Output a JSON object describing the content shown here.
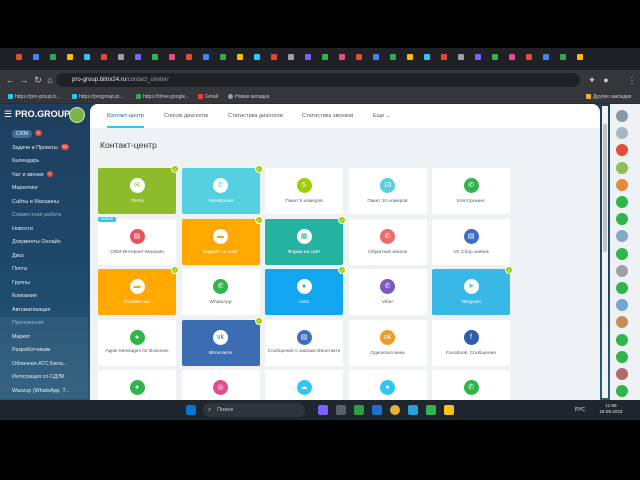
{
  "browser": {
    "url_host": "pro-group.bitrix24.ru",
    "url_path": "/contact_center/",
    "bookmarks": [
      "https://pro-group.b...",
      "https://progroup.pl...",
      "https://drive.google...",
      "Gmail",
      "Новая вкладка"
    ],
    "bookmarks_right": "Другие закладки"
  },
  "app": {
    "logo": "PRO.GROUP",
    "sidebar": [
      {
        "label": "CRM",
        "badge": "5"
      },
      {
        "label": "Задачи и Проекты",
        "badge": "99"
      },
      {
        "label": "Календарь",
        "badge": ""
      },
      {
        "label": "Чат и звонки",
        "badge": "1"
      },
      {
        "label": "Маркетинг",
        "badge": ""
      },
      {
        "label": "Сайты и Магазины",
        "badge": ""
      },
      {
        "label": "Совместная работа",
        "badge": ""
      },
      {
        "label": "Новости",
        "badge": ""
      },
      {
        "label": "Документы Онлайн",
        "badge": ""
      },
      {
        "label": "Диск",
        "badge": ""
      },
      {
        "label": "Почта",
        "badge": ""
      },
      {
        "label": "Группы",
        "badge": ""
      },
      {
        "label": "Компания",
        "badge": ""
      },
      {
        "label": "Автоматизация",
        "badge": ""
      },
      {
        "label": "Приложения",
        "badge": ""
      },
      {
        "label": "Маркет",
        "badge": ""
      },
      {
        "label": "Разработчикам",
        "badge": ""
      },
      {
        "label": "Облачная АТС Била...",
        "badge": ""
      },
      {
        "label": "Интеграция со СДЭК",
        "badge": ""
      },
      {
        "label": "Wazzup (WhatsApp, T...",
        "badge": ""
      }
    ]
  },
  "topnav": {
    "tabs": [
      "Контакт-центр",
      "Список диалогов",
      "Статистика диалогов",
      "Статистика звонков",
      "Еще"
    ]
  },
  "page_title": "Контакт-центр",
  "tiles": [
    {
      "label": "Почта",
      "icon": "mail-icon",
      "glyph": "✉",
      "bg": "#8dbb2c",
      "ic_bg": "#ffffff",
      "ic_fg": "#8dbb2c",
      "connected": true,
      "filled": true
    },
    {
      "label": "Телефония",
      "icon": "phone-icon",
      "glyph": "✆",
      "bg": "#55d0e0",
      "ic_bg": "#ffffff",
      "ic_fg": "#55d0e0",
      "connected": true,
      "filled": true
    },
    {
      "label": "Пакет 5 номеров",
      "icon": "number-pack-icon",
      "glyph": "5",
      "bg": "#ffffff",
      "ic_bg": "#9dcf00",
      "ic_fg": "#ffffff",
      "connected": false,
      "filled": false
    },
    {
      "label": "Пакет 10 номеров",
      "icon": "number-pack-icon",
      "glyph": "10",
      "bg": "#ffffff",
      "ic_bg": "#55d0e0",
      "ic_fg": "#ffffff",
      "connected": false,
      "filled": false
    },
    {
      "label": "Коллтрекинг",
      "icon": "calltracking-icon",
      "glyph": "✆",
      "bg": "#ffffff",
      "ic_bg": "#2fb54c",
      "ic_fg": "#ffffff",
      "connected": false,
      "filled": false
    },
    {
      "label": "CRM-Интернет-Магазин",
      "icon": "shop-icon",
      "glyph": "▤",
      "bg": "#ffffff",
      "ic_bg": "#e4545f",
      "ic_fg": "#ffffff",
      "connected": false,
      "filled": false,
      "tag": "НОВОЕ"
    },
    {
      "label": "Виджет на сайт",
      "icon": "widget-icon",
      "glyph": "▬",
      "bg": "#ffa900",
      "ic_bg": "#ffffff",
      "ic_fg": "#ffa900",
      "connected": true,
      "filled": true
    },
    {
      "label": "Форма на сайт",
      "icon": "form-icon",
      "glyph": "▦",
      "bg": "#25b3a1",
      "ic_bg": "#ffffff",
      "ic_fg": "#25b3a1",
      "connected": true,
      "filled": true
    },
    {
      "label": "Обратный звонок",
      "icon": "callback-icon",
      "glyph": "✆",
      "bg": "#ffffff",
      "ic_bg": "#ef6a6a",
      "ic_fg": "#ffffff",
      "connected": false,
      "filled": false
    },
    {
      "label": "VK Сбор заявок",
      "icon": "vk-leads-icon",
      "glyph": "▤",
      "bg": "#ffffff",
      "ic_bg": "#3c6dbf",
      "ic_fg": "#ffffff",
      "connected": false,
      "filled": false
    },
    {
      "label": "Онлайн-чат",
      "icon": "chat-icon",
      "glyph": "▬",
      "bg": "#ffa900",
      "ic_bg": "#ffffff",
      "ic_fg": "#ffa900",
      "connected": true,
      "filled": true
    },
    {
      "label": "WhatsApp",
      "icon": "whatsapp-icon",
      "glyph": "✆",
      "bg": "#ffffff",
      "ic_bg": "#2fb54c",
      "ic_fg": "#ffffff",
      "connected": false,
      "filled": false
    },
    {
      "label": "Avito",
      "icon": "avito-icon",
      "glyph": "●",
      "bg": "#12a6f0",
      "ic_bg": "#ffffff",
      "ic_fg": "#12a6f0",
      "connected": true,
      "filled": true
    },
    {
      "label": "Viber",
      "icon": "viber-icon",
      "glyph": "✆",
      "bg": "#ffffff",
      "ic_bg": "#7e57c2",
      "ic_fg": "#ffffff",
      "connected": false,
      "filled": false
    },
    {
      "label": "Telegram",
      "icon": "telegram-icon",
      "glyph": "➤",
      "bg": "#38b8e6",
      "ic_bg": "#ffffff",
      "ic_fg": "#38b8e6",
      "connected": true,
      "filled": true
    },
    {
      "label": "Apple Messages for Business",
      "icon": "apple-messages-icon",
      "glyph": "●",
      "bg": "#ffffff",
      "ic_bg": "#2fb54c",
      "ic_fg": "#ffffff",
      "connected": false,
      "filled": false
    },
    {
      "label": "ВКонтакте",
      "icon": "vk-icon",
      "glyph": "vk",
      "bg": "#3c6db2",
      "ic_bg": "#ffffff",
      "ic_fg": "#3c6db2",
      "connected": true,
      "filled": true
    },
    {
      "label": "Сообщения о заказах ВКонтакте",
      "icon": "vk-orders-icon",
      "glyph": "▤",
      "bg": "#ffffff",
      "ic_bg": "#3c6dbf",
      "ic_fg": "#ffffff",
      "connected": false,
      "filled": false
    },
    {
      "label": "Одноклассники",
      "icon": "ok-icon",
      "glyph": "ok",
      "bg": "#ffffff",
      "ic_bg": "#f39c1f",
      "ic_fg": "#ffffff",
      "connected": false,
      "filled": false
    },
    {
      "label": "Facebook: Сообщения",
      "icon": "facebook-icon",
      "glyph": "f",
      "bg": "#ffffff",
      "ic_bg": "#2d5ea8",
      "ic_fg": "#ffffff",
      "connected": false,
      "filled": false
    },
    {
      "label": "",
      "icon": "channel-icon",
      "glyph": "●",
      "bg": "#ffffff",
      "ic_bg": "#2fb54c",
      "ic_fg": "#ffffff",
      "connected": false,
      "filled": false
    },
    {
      "label": "",
      "icon": "instagram-icon",
      "glyph": "◎",
      "bg": "#ffffff",
      "ic_bg": "#e24d8f",
      "ic_fg": "#ffffff",
      "connected": false,
      "filled": false
    },
    {
      "label": "",
      "icon": "cloud-icon",
      "glyph": "☁",
      "bg": "#ffffff",
      "ic_bg": "#2fc6f6",
      "ic_fg": "#ffffff",
      "connected": false,
      "filled": false
    },
    {
      "label": "",
      "icon": "channel-icon",
      "glyph": "●",
      "bg": "#ffffff",
      "ic_bg": "#2fc6f6",
      "ic_fg": "#ffffff",
      "connected": false,
      "filled": false
    },
    {
      "label": "",
      "icon": "whatsapp-icon",
      "glyph": "✆",
      "bg": "#ffffff",
      "ic_bg": "#2fb54c",
      "ic_fg": "#ffffff",
      "connected": false,
      "filled": false
    }
  ],
  "taskbar": {
    "search_label": "Поиск",
    "lang": "РУС",
    "time": "11:59",
    "date": "16.09.2023"
  }
}
